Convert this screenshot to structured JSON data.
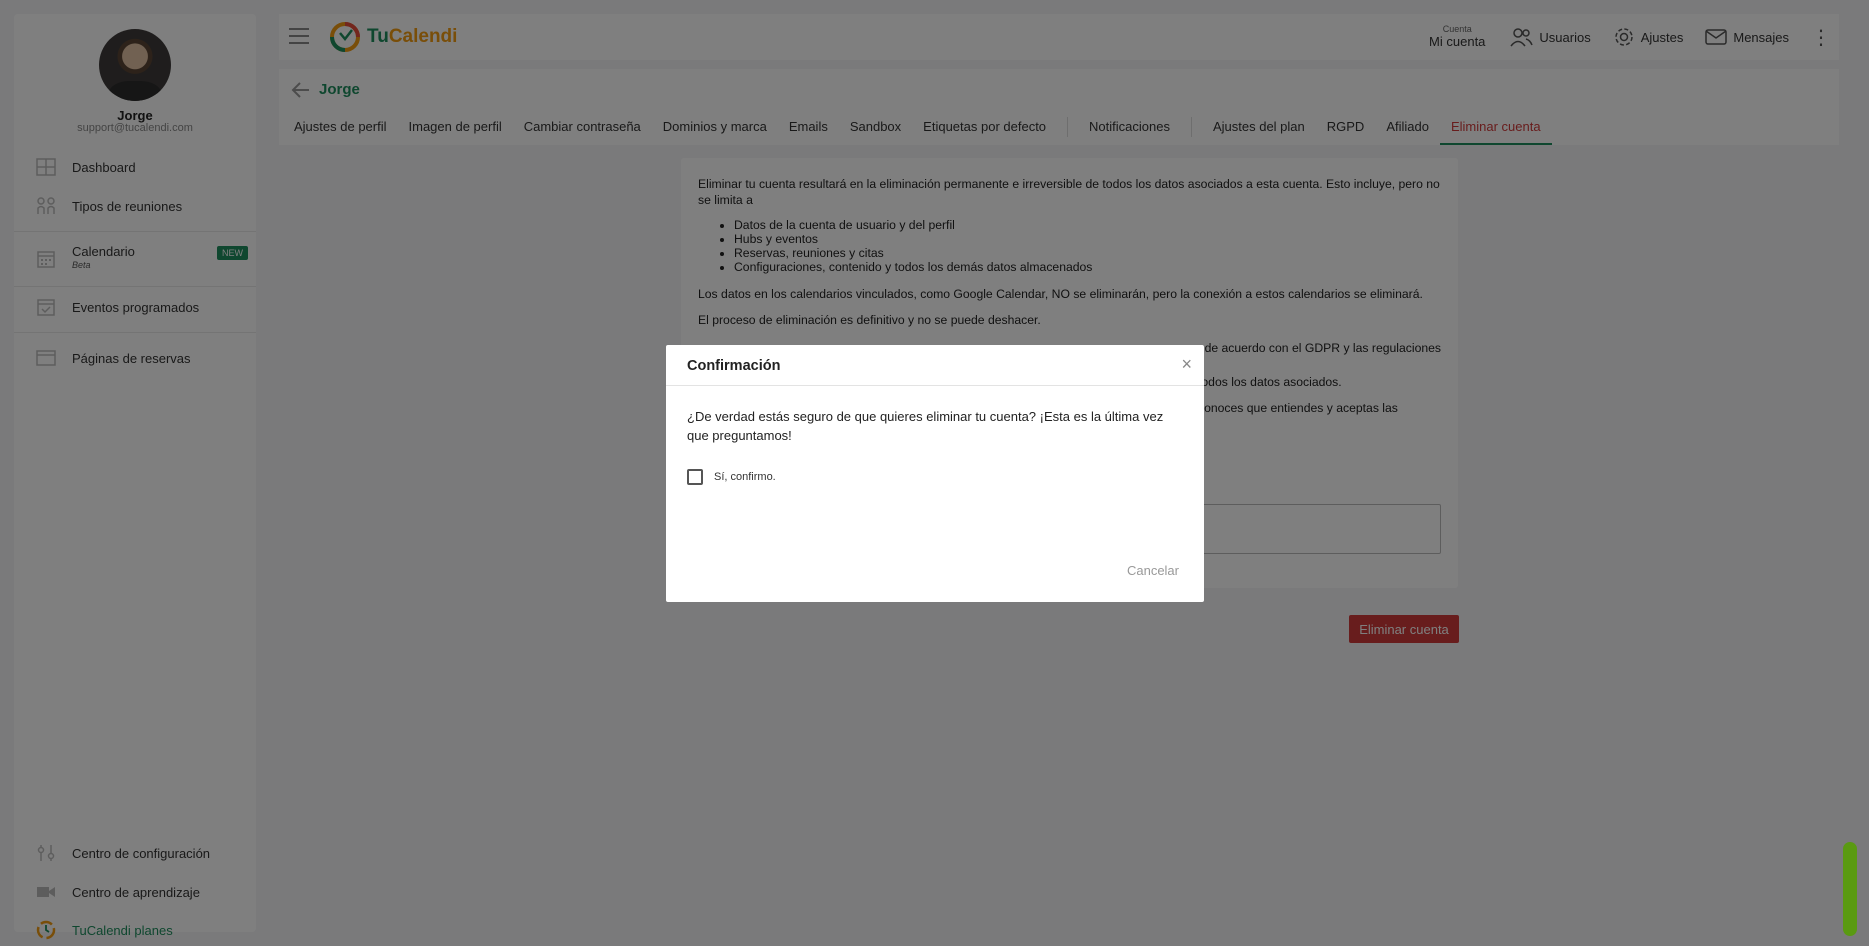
{
  "sidebar": {
    "user_name": "Jorge",
    "user_email": "support@tucalendi.com",
    "items": [
      {
        "label": "Dashboard",
        "icon": "grid-icon"
      },
      {
        "label": "Tipos de reuniones",
        "icon": "people-icon"
      },
      {
        "label": "Calendario",
        "icon": "calendar-icon",
        "badge": "NEW",
        "sub": "Beta"
      },
      {
        "label": "Eventos programados",
        "icon": "calendar-check-icon"
      },
      {
        "label": "Páginas de reservas",
        "icon": "browser-window-icon"
      }
    ],
    "bottom_items": [
      {
        "label": "Centro de configuración",
        "icon": "sliders-icon"
      },
      {
        "label": "Centro de aprendizaje",
        "icon": "video-icon"
      },
      {
        "label": "TuCalendi planes",
        "icon": "tucalendi-logo-icon"
      }
    ]
  },
  "topbar": {
    "logo_text_tu": "Tu",
    "logo_text_calendi": "Calendi",
    "account_small": "Cuenta",
    "account_big": "Mi cuenta",
    "users": "Usuarios",
    "settings": "Ajustes",
    "messages": "Mensajes"
  },
  "page": {
    "title": "Jorge",
    "tabs": [
      "Ajustes de perfil",
      "Imagen de perfil",
      "Cambiar contraseña",
      "Dominios y marca",
      "Emails",
      "Sandbox",
      "Etiquetas por defecto",
      "Notificaciones",
      "Ajustes del plan",
      "RGPD",
      "Afiliado",
      "Eliminar cuenta"
    ],
    "active_tab": "Eliminar cuenta"
  },
  "content": {
    "intro": "Eliminar tu cuenta resultará en la eliminación permanente e irreversible de todos los datos asociados a esta cuenta. Esto incluye, pero no se limita a",
    "list": [
      "Datos de la cuenta de usuario y del perfil",
      "Hubs y eventos",
      "Reservas, reuniones y citas",
      "Configuraciones, contenido y todos los demás datos almacenados"
    ],
    "p_calendars": "Los datos en los calendarios vinculados, como Google Calendar, NO se eliminarán, pero la conexión a estos calendarios se eliminará.",
    "p_final": "El proceso de eliminación es definitivo y no se puede deshacer.",
    "p_gdpr_tail": "de acuerdo con el GDPR y las regulaciones",
    "p_data_tail": "todos los datos asociados.",
    "p_accept_tail": "conoces que entiendes y aceptas las",
    "delete_button": "Eliminar cuenta"
  },
  "modal": {
    "title": "Confirmación",
    "close": "×",
    "body": "¿De verdad estás seguro de que quieres eliminar tu cuenta? ¡Esta es la última vez que preguntamos!",
    "checkbox_label": "Sí, confirmo.",
    "cancel": "Cancelar"
  },
  "colors": {
    "brand_green": "#1e8e5e",
    "danger": "#d13b3b",
    "logo_orange": "#f39c12"
  }
}
